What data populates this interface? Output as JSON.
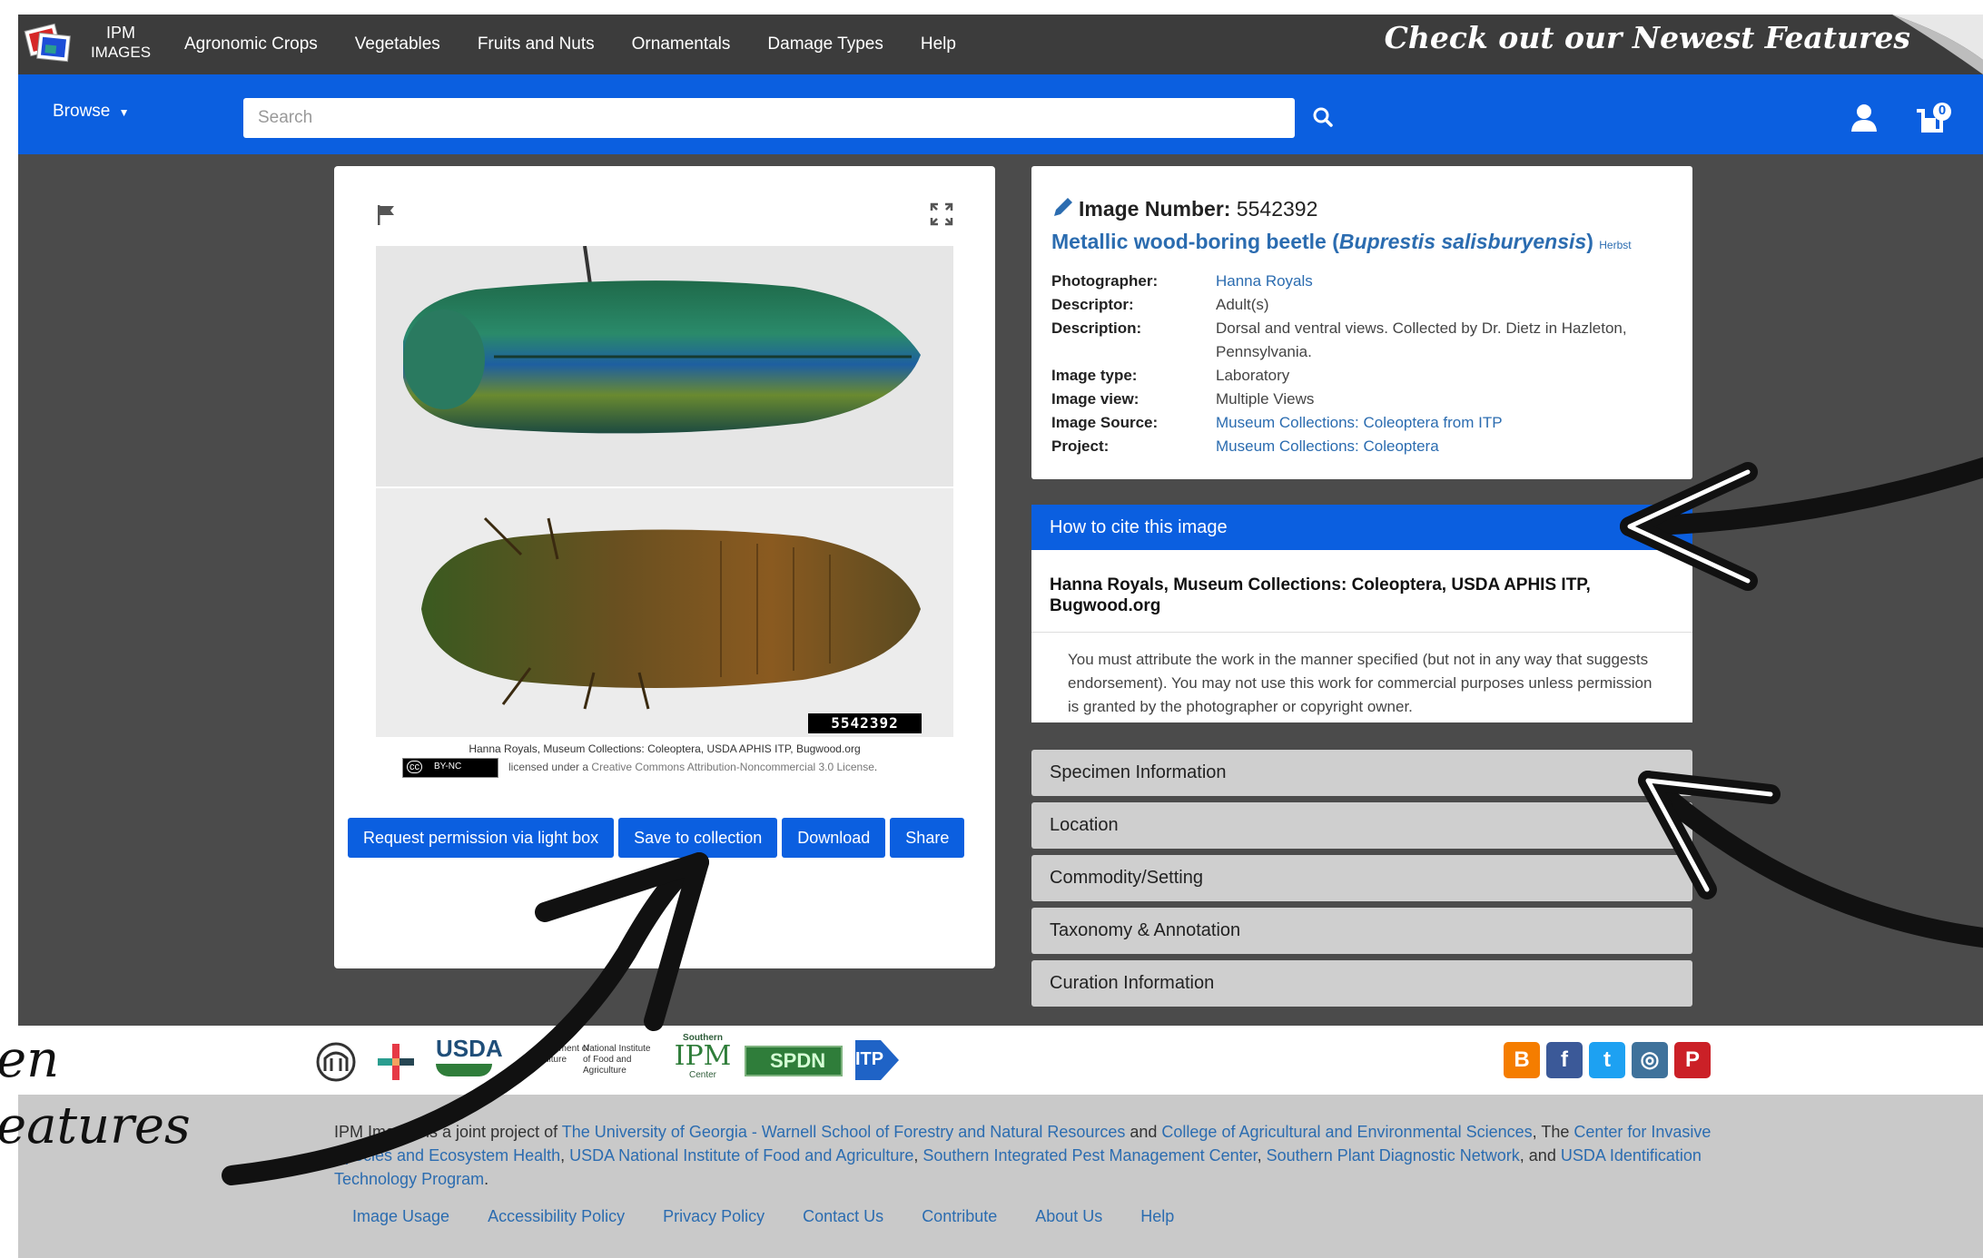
{
  "topnav": {
    "logo_line1": "IPM",
    "logo_line2": "IMAGES",
    "links": [
      "Agronomic Crops",
      "Vegetables",
      "Fruits and Nuts",
      "Ornamentals",
      "Damage Types",
      "Help"
    ],
    "promo": "Check out our Newest Features"
  },
  "searchbar": {
    "browse_label": "Browse",
    "placeholder": "Search",
    "cart_count": "0"
  },
  "image_panel": {
    "image_number_tag": "5542392",
    "credit": "Hanna Royals, Museum Collections: Coleoptera, USDA APHIS ITP, Bugwood.org",
    "license_badge": "BY-NC",
    "license_prefix": "licensed under a",
    "license_link": "Creative Commons Attribution-Noncommercial 3.0 License",
    "license_suffix": ".",
    "buttons": [
      "Request permission via light box",
      "Save to collection",
      "Download",
      "Share"
    ]
  },
  "info": {
    "image_number_label": "Image Number:",
    "image_number": "5542392",
    "common_name": "Metallic wood-boring beetle (",
    "scientific_name": "Buprestis salisburyensis",
    "name_close": ")",
    "authority": "Herbst",
    "fields": [
      {
        "label": "Photographer:",
        "value": "Hanna Royals",
        "link": true
      },
      {
        "label": "Descriptor:",
        "value": "Adult(s)",
        "link": false
      },
      {
        "label": "Description:",
        "value": "Dorsal and ventral views. Collected by Dr. Dietz in Hazleton, Pennsylvania.",
        "link": false
      },
      {
        "label": "Image type:",
        "value": "Laboratory",
        "link": false
      },
      {
        "label": "Image view:",
        "value": "Multiple Views",
        "link": false
      },
      {
        "label": "Image Source:",
        "value": "Museum Collections: Coleoptera from ITP",
        "link": true
      },
      {
        "label": "Project:",
        "value": "Museum Collections: Coleoptera",
        "link": true
      }
    ]
  },
  "cite": {
    "heading": "How to cite this image",
    "citation": "Hanna Royals, Museum Collections: Coleoptera, USDA APHIS ITP, Bugwood.org",
    "note": "You must attribute the work in the manner specified (but not in any way that suggests endorsement). You may not use this work for commercial purposes unless permission is granted by the photographer or copyright owner."
  },
  "accordion": [
    "Specimen Information",
    "Location",
    "Commodity/Setting",
    "Taxonomy & Annotation",
    "Curation Information"
  ],
  "footer": {
    "logos": {
      "usda": "USDA",
      "usda_partial": "ates ment of culture",
      "nifa": "National Institute of Food and Agriculture",
      "sipm_small": "Southern",
      "sipm": "IPM",
      "sipm_center": "Center",
      "spdn": "SPDN",
      "itp": "ITP"
    },
    "text_parts": [
      {
        "t": "IPM Images is a joint project of ",
        "a": false
      },
      {
        "t": "The University of Georgia - Warnell School of Forestry and Natural Resources",
        "a": true
      },
      {
        "t": " and ",
        "a": false
      },
      {
        "t": "College of Agricultural and Environmental Sciences",
        "a": true
      },
      {
        "t": ", The ",
        "a": false
      },
      {
        "t": "Center for Invasive Species and Ecosystem Health",
        "a": true
      },
      {
        "t": ", ",
        "a": false
      },
      {
        "t": "USDA National Institute of Food and Agriculture",
        "a": true
      },
      {
        "t": ", ",
        "a": false
      },
      {
        "t": "Southern Integrated Pest Management Center",
        "a": true
      },
      {
        "t": ", ",
        "a": false
      },
      {
        "t": "Southern Plant Diagnostic Network",
        "a": true
      },
      {
        "t": ", and ",
        "a": false
      },
      {
        "t": "USDA Identification Technology Program",
        "a": true
      },
      {
        "t": ".",
        "a": false
      }
    ],
    "links": [
      "Image Usage",
      "Accessibility Policy",
      "Privacy Policy",
      "Contact Us",
      "Contribute",
      "About Us",
      "Help"
    ],
    "social": [
      {
        "name": "blogger-icon",
        "glyph": "B",
        "color": "#f57d00"
      },
      {
        "name": "facebook-icon",
        "glyph": "f",
        "color": "#3b5998"
      },
      {
        "name": "twitter-icon",
        "glyph": "t",
        "color": "#1da1f2"
      },
      {
        "name": "instagram-icon",
        "glyph": "◎",
        "color": "#3f729b"
      },
      {
        "name": "pinterest-icon",
        "glyph": "P",
        "color": "#cb2027"
      }
    ]
  },
  "annotation": {
    "line1": "en",
    "line2": "eatures"
  },
  "colors": {
    "brand_blue": "#0b5fe0",
    "page_bg": "#4b4b4b",
    "link_blue": "#2b6cb0"
  }
}
